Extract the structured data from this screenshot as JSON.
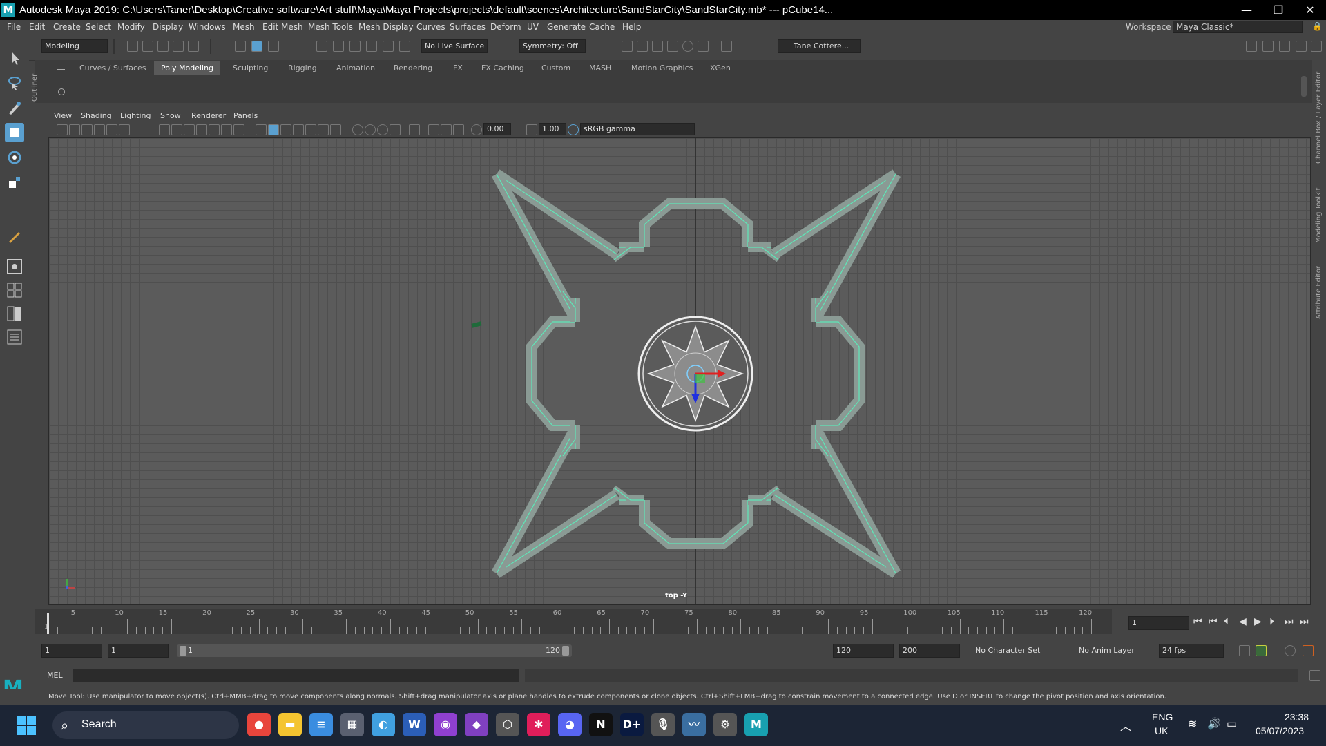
{
  "titlebar": {
    "logo": "M",
    "title": "Autodesk Maya 2019: C:\\Users\\Taner\\Desktop\\Creative software\\Art stuff\\Maya\\Maya Projects\\projects\\default\\scenes\\Architecture\\SandStarCity\\SandStarCity.mb*   ---   pCube14...",
    "minimize": "—",
    "restore": "❐",
    "close": "✕"
  },
  "menubar": {
    "items": [
      "File",
      "Edit",
      "Create",
      "Select",
      "Modify",
      "Display",
      "Windows",
      "Mesh",
      "Edit Mesh",
      "Mesh Tools",
      "Mesh Display",
      "Curves",
      "Surfaces",
      "Deform",
      "UV",
      "Generate",
      "Cache",
      "Help"
    ],
    "workspace_label": "Workspace :",
    "workspace_value": "Maya Classic*"
  },
  "statusline": {
    "menuset": "Modeling",
    "live_surface": "No Live Surface",
    "symmetry": "Symmetry: Off",
    "user": "Tane Cottere..."
  },
  "shelf": {
    "tabs": [
      "Curves / Surfaces",
      "Poly Modeling",
      "Sculpting",
      "Rigging",
      "Animation",
      "Rendering",
      "FX",
      "FX Caching",
      "Custom",
      "MASH",
      "Motion Graphics",
      "XGen"
    ],
    "active_tab": "Poly Modeling"
  },
  "side_tabs": {
    "outliner": "Outliner",
    "channel_box": "Channel Box / Layer Editor",
    "modeling_toolkit": "Modeling Toolkit",
    "attribute_editor": "Attribute Editor"
  },
  "panel": {
    "menus": [
      "View",
      "Shading",
      "Lighting",
      "Show",
      "Renderer",
      "Panels"
    ],
    "exposure": "0.00",
    "gamma": "1.00",
    "color_space": "sRGB gamma",
    "camera_label": "top -Y"
  },
  "colors": {
    "wire": "#5ee8b8",
    "mesh_fill": "#8a9a94",
    "accent": "#5aa0d0"
  },
  "timeline": {
    "ticks": [
      "5",
      "10",
      "15",
      "20",
      "25",
      "30",
      "35",
      "40",
      "45",
      "50",
      "55",
      "60",
      "65",
      "70",
      "75",
      "80",
      "85",
      "90",
      "95",
      "100",
      "105",
      "110",
      "115",
      "120"
    ],
    "current_frame": "1",
    "start_frame_marker": "1"
  },
  "range": {
    "start": "1",
    "playback_start": "1",
    "slider_start": "1",
    "slider_end": "120",
    "playback_end": "120",
    "end": "200",
    "character_set": "No Character Set",
    "anim_layer": "No Anim Layer",
    "fps": "24 fps"
  },
  "cmdline": {
    "label": "MEL"
  },
  "helpline": {
    "text": "Move Tool: Use manipulator to move object(s). Ctrl+MMB+drag to move components along normals. Shift+drag manipulator axis or plane handles to extrude components or clone objects. Ctrl+Shift+LMB+drag to constrain movement to a connected edge. Use D or INSERT to change the pivot position and axis orientation."
  },
  "taskbar": {
    "search_placeholder": "Search",
    "language": "ENG",
    "region": "UK",
    "time": "23:38",
    "date": "05/07/2023",
    "apps": [
      "chrome-icon",
      "file-explorer-icon",
      "notepad-icon",
      "calculator-icon",
      "photos-icon",
      "word-icon",
      "github-icon",
      "visual-studio-icon",
      "unity-icon",
      "slack-icon",
      "discord-icon",
      "netflix-icon",
      "disney-plus-icon",
      "mic-icon",
      "stocks-icon",
      "settings-icon",
      "maya-icon"
    ]
  }
}
